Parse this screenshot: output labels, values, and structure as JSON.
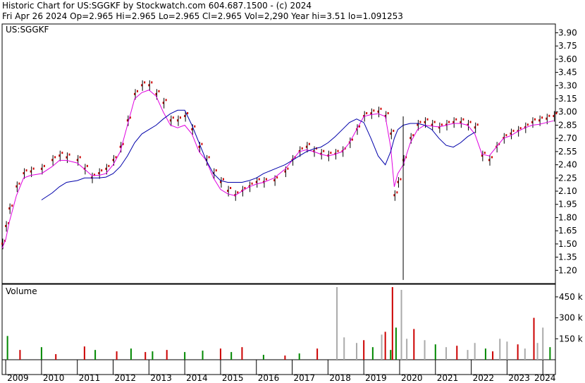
{
  "header": {
    "title_line": "Historic Chart for US:SGGKF by Stockwatch.com 604.687.1500 - (c) 2024",
    "info_line": "Fri Apr 26 2024   Op=2.965   Hi=2.965   Lo=2.965   Cl=2.965   Vol=2,290   Year hi=3.51   lo=1.091253"
  },
  "chart_data": [
    {
      "type": "line",
      "title": "US:SGGKF",
      "x": [
        2008.9,
        2009.0,
        2009.1,
        2009.3,
        2009.5,
        2009.7,
        2010.0,
        2010.3,
        2010.5,
        2010.7,
        2011.0,
        2011.2,
        2011.4,
        2011.6,
        2011.8,
        2012.0,
        2012.2,
        2012.4,
        2012.6,
        2012.8,
        2013.0,
        2013.2,
        2013.4,
        2013.6,
        2013.8,
        2014.0,
        2014.2,
        2014.4,
        2014.6,
        2014.8,
        2015.0,
        2015.2,
        2015.4,
        2015.6,
        2015.8,
        2016.0,
        2016.2,
        2016.5,
        2016.8,
        2017.0,
        2017.2,
        2017.4,
        2017.6,
        2017.8,
        2018.0,
        2018.2,
        2018.4,
        2018.6,
        2018.8,
        2019.0,
        2019.2,
        2019.4,
        2019.6,
        2019.75,
        2019.85,
        2019.95,
        2020.1,
        2020.3,
        2020.5,
        2020.7,
        2020.9,
        2021.1,
        2021.3,
        2021.5,
        2021.7,
        2021.9,
        2022.1,
        2022.3,
        2022.5,
        2022.7,
        2022.9,
        2023.1,
        2023.3,
        2023.5,
        2023.7,
        2023.9,
        2024.1,
        2024.3
      ],
      "ylim": [
        1.05,
        4.0
      ],
      "xlim": [
        2008.9,
        2024.35
      ],
      "y_ticks": [
        3.9,
        3.75,
        3.6,
        3.45,
        3.3,
        3.15,
        3.0,
        2.85,
        2.7,
        2.55,
        2.4,
        2.25,
        2.1,
        1.95,
        1.8,
        1.65,
        1.5,
        1.35,
        1.2
      ],
      "y_tick_labels": [
        "3.90",
        "3.75",
        "3.60",
        "3.45",
        "3.30",
        "3.15",
        "3.00",
        "2.85",
        "2.70",
        "2.55",
        "2.40",
        "2.25",
        "2.10",
        "1.95",
        "1.80",
        "1.65",
        "1.50",
        "1.35",
        "1.20"
      ],
      "x_tick_labels": [
        "2009",
        "2010",
        "2011",
        "2012",
        "2013",
        "2014",
        "2015",
        "2016",
        "2017",
        "2018",
        "2019",
        "2020",
        "2021",
        "2022",
        "2023",
        "2024"
      ],
      "series": [
        {
          "values": [
            1.5,
            1.7,
            1.9,
            2.15,
            2.3,
            2.32,
            2.35,
            2.45,
            2.5,
            2.48,
            2.45,
            2.35,
            2.25,
            2.3,
            2.35,
            2.45,
            2.6,
            2.9,
            3.2,
            3.3,
            3.3,
            3.2,
            3.1,
            2.9,
            2.9,
            2.95,
            2.8,
            2.6,
            2.45,
            2.3,
            2.2,
            2.1,
            2.05,
            2.1,
            2.15,
            2.2,
            2.2,
            2.22,
            2.32,
            2.45,
            2.55,
            2.6,
            2.55,
            2.52,
            2.5,
            2.52,
            2.55,
            2.65,
            2.8,
            2.95,
            2.98,
            3.0,
            2.95,
            2.75,
            2.05,
            2.2,
            2.45,
            2.7,
            2.85,
            2.88,
            2.85,
            2.82,
            2.85,
            2.88,
            2.88,
            2.85,
            2.82,
            2.5,
            2.45,
            2.6,
            2.7,
            2.75,
            2.78,
            2.82,
            2.88,
            2.9,
            2.92,
            2.95
          ],
          "color": "#cc0000",
          "style": "daily-bars"
        },
        {
          "values": [
            1.45,
            1.55,
            1.75,
            2.05,
            2.25,
            2.28,
            2.3,
            2.38,
            2.45,
            2.45,
            2.42,
            2.35,
            2.28,
            2.28,
            2.3,
            2.4,
            2.55,
            2.85,
            3.15,
            3.22,
            3.25,
            3.18,
            3.0,
            2.85,
            2.82,
            2.85,
            2.75,
            2.55,
            2.45,
            2.25,
            2.12,
            2.07,
            2.05,
            2.1,
            2.15,
            2.18,
            2.2,
            2.25,
            2.35,
            2.45,
            2.55,
            2.57,
            2.55,
            2.52,
            2.5,
            2.52,
            2.55,
            2.65,
            2.8,
            2.95,
            2.97,
            2.98,
            2.95,
            2.6,
            2.15,
            2.3,
            2.4,
            2.65,
            2.8,
            2.85,
            2.84,
            2.83,
            2.85,
            2.87,
            2.87,
            2.85,
            2.75,
            2.52,
            2.5,
            2.6,
            2.7,
            2.73,
            2.78,
            2.82,
            2.85,
            2.86,
            2.88,
            2.9
          ],
          "color": "#e000e0"
        },
        {
          "values": [
            null,
            null,
            null,
            null,
            null,
            null,
            2.0,
            2.08,
            2.15,
            2.2,
            2.22,
            2.25,
            2.25,
            2.25,
            2.26,
            2.3,
            2.38,
            2.5,
            2.65,
            2.75,
            2.8,
            2.85,
            2.92,
            2.98,
            3.02,
            3.02,
            2.85,
            2.65,
            2.45,
            2.3,
            2.22,
            2.2,
            2.2,
            2.2,
            2.22,
            2.25,
            2.3,
            2.35,
            2.4,
            2.45,
            2.5,
            2.55,
            2.58,
            2.6,
            2.65,
            2.72,
            2.8,
            2.88,
            2.92,
            2.88,
            2.7,
            2.5,
            2.4,
            2.55,
            2.7,
            2.8,
            2.85,
            2.87,
            2.87,
            2.85,
            2.8,
            2.7,
            2.62,
            2.6,
            2.65,
            2.72,
            2.77
          ],
          "color": "#0000aa"
        }
      ]
    },
    {
      "type": "bar",
      "title": "Volume",
      "ylim": [
        0,
        500000
      ],
      "y_ticks": [
        450000,
        300000,
        150000
      ],
      "y_tick_labels": [
        "450 k",
        "300 k",
        "150 k"
      ],
      "x": [
        2009.05,
        2009.4,
        2010.0,
        2010.4,
        2011.2,
        2011.5,
        2012.1,
        2012.5,
        2012.9,
        2013.1,
        2013.5,
        2014.0,
        2014.5,
        2015.0,
        2015.3,
        2015.6,
        2016.2,
        2016.8,
        2017.2,
        2017.7,
        2018.25,
        2018.45,
        2018.8,
        2019.0,
        2019.25,
        2019.5,
        2019.6,
        2019.75,
        2019.8,
        2019.9,
        2020.05,
        2020.2,
        2020.4,
        2020.7,
        2021.0,
        2021.3,
        2021.6,
        2021.9,
        2022.1,
        2022.4,
        2022.6,
        2022.8,
        2023.0,
        2023.3,
        2023.5,
        2023.75,
        2023.85,
        2024.0,
        2024.2
      ],
      "values": [
        170000,
        70000,
        90000,
        40000,
        95000,
        70000,
        60000,
        80000,
        55000,
        60000,
        70000,
        55000,
        65000,
        80000,
        55000,
        90000,
        35000,
        30000,
        45000,
        80000,
        520000,
        160000,
        120000,
        140000,
        90000,
        180000,
        200000,
        70000,
        520000,
        230000,
        500000,
        150000,
        220000,
        140000,
        110000,
        90000,
        100000,
        70000,
        120000,
        80000,
        60000,
        150000,
        130000,
        110000,
        80000,
        300000,
        120000,
        230000,
        90000
      ],
      "colors": [
        "#008800",
        "#cc0000",
        "#008800",
        "#cc0000",
        "#cc0000",
        "#008800",
        "#cc0000",
        "#008800",
        "#cc0000",
        "#008800",
        "#cc0000",
        "#008800",
        "#008800",
        "#cc0000",
        "#008800",
        "#cc0000",
        "#008800",
        "#cc0000",
        "#008800",
        "#cc0000",
        "#aaaaaa",
        "#aaaaaa",
        "#aaaaaa",
        "#cc0000",
        "#008800",
        "#aaaaaa",
        "#cc0000",
        "#008800",
        "#cc0000",
        "#008800",
        "#aaaaaa",
        "#aaaaaa",
        "#cc0000",
        "#aaaaaa",
        "#008800",
        "#aaaaaa",
        "#cc0000",
        "#aaaaaa",
        "#aaaaaa",
        "#008800",
        "#cc0000",
        "#aaaaaa",
        "#aaaaaa",
        "#cc0000",
        "#aaaaaa",
        "#cc0000",
        "#aaaaaa",
        "#aaaaaa",
        "#008800"
      ]
    }
  ]
}
